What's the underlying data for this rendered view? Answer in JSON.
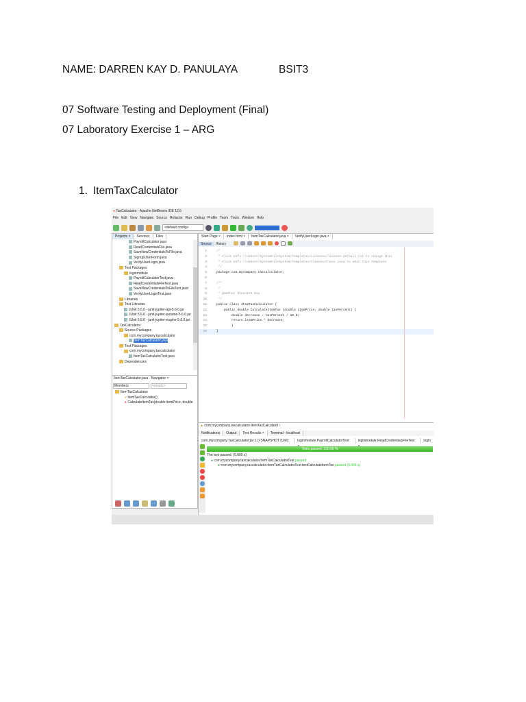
{
  "doc": {
    "name_line": "NAME: DARREN KAY D. PANULAYA",
    "section": "BSIT3",
    "course": "07 Software Testing and Deployment (Final)",
    "exercise": "07 Laboratory Exercise 1 – ARG",
    "item_number": "1.",
    "item_title": "ItemTaxCalculator"
  },
  "ide": {
    "title": "TaxCalculator - Apache NetBeans IDE 12.6",
    "menu": [
      "File",
      "Edit",
      "View",
      "Navigate",
      "Source",
      "Refactor",
      "Run",
      "Debug",
      "Profile",
      "Team",
      "Tools",
      "Window",
      "Help"
    ],
    "config": "<default config>",
    "left_tabs": [
      "Projects ×",
      "Services",
      "Files"
    ],
    "tree": [
      "PayrollCalculator.java",
      "ReadCredentialsFile.java",
      "SaveNewCredentialsToFile.java",
      "SignupUserForm.java",
      "VerifyUserLogin.java",
      "Test Packages",
      "loginmodule",
      "PayrollCalculatorTest.java",
      "ReadCredentialsFileTest.java",
      "SaveNewCredentialsToFileTest.java",
      "VerifyUserLoginTest.java",
      "Libraries",
      "Test Libraries",
      "JUnit 5.6.0 - junit-jupiter-api-5.6.0.jar",
      "JUnit 5.6.0 - junit-jupiter-params-5.6.0.jar",
      "JUnit 5.6.0 - junit-jupiter-engine-5.6.0.jar",
      "TaxCalculator",
      "Source Packages",
      "com.mycompany.taxcalculator",
      "ItemTaxCalculator.java",
      "Test Packages",
      "com.mycompany.taxcalculator",
      "ItemTaxCalculatorTest.java",
      "Dependencies"
    ],
    "navigator_title": "ItemTaxCalculator.java - Navigator ×",
    "members": "Members",
    "empty": "<empty>",
    "nav_tree": [
      "ItemTaxCalculator",
      "ItemTaxCalculator()",
      "CalculateItemTax(double itemPrice, double"
    ],
    "editor_tabs": [
      "Start Page ×",
      "index.html ×",
      "ItemTaxCalculator.java ×",
      "VerifyUserLogin.java ×"
    ],
    "source_tab": "Source",
    "history_tab": "History",
    "code": [
      "/*",
      " * Click nbfs://nbhost/SystemFileSystem/Templates/Licenses/license-default.txt to change this",
      " * Click nbfs://nbhost/SystemFileSystem/Templates/Classes/Class.java to edit this template",
      " */",
      "package com.mycompany.taxcalculator;",
      "",
      "/**",
      " *",
      " * @author Shannite Kay",
      " */",
      "public class ItemTaxCalculator {",
      "    public double CalculateItemTax (double itemPrice, double taxPercent) {",
      "        double decrease = taxPercent / 10.0;",
      "        return itemPrice * decrease;",
      "        }",
      "}"
    ],
    "breadcrumb": "com.mycompany.taxcalculator.ItemTaxCalculator",
    "output_tabs": [
      "Notifications",
      "Output",
      "Test Results ×",
      "Terminal - localhost"
    ],
    "test_tabs": [
      "com.mycompany:TaxCalculator:jar:1.0-SNAPSHOT (Unit) ×",
      "loginmodule.PayrollCalculatorTest ×",
      "loginmodule.ReadCredentialsFileTest ×",
      "login"
    ],
    "progress_label": "Tests passed: 100.00 %",
    "progress": 100,
    "summary": "The test passed. (0.000 s)",
    "test_class": "com.mycompany.taxcalculator.ItemTaxCalculatorTest",
    "test_class_status": "passed",
    "test_method": "com.mycompany.taxcalculator.ItemTaxCalculatorTest.testCalculateItemTax",
    "test_method_status": "passed",
    "test_method_time": "(0.006 s)"
  }
}
